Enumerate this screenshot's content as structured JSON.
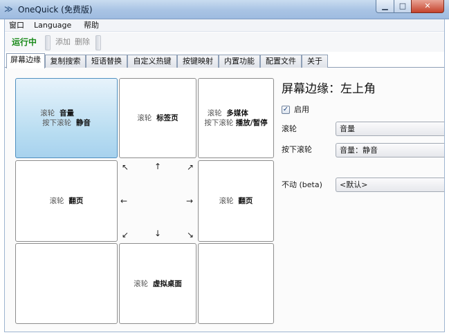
{
  "window": {
    "title": "OneQuick (免费版)",
    "minimize_glyph": "▁",
    "maximize_glyph": "□",
    "close_glyph": "✕"
  },
  "menubar": {
    "items": [
      "窗口",
      "Language",
      "帮助"
    ]
  },
  "toolbar": {
    "run_label": "运行中",
    "add_label": "添加",
    "delete_label": "删除"
  },
  "tabs": [
    {
      "label": "屏幕边缘",
      "active": true
    },
    {
      "label": "复制搜索"
    },
    {
      "label": "短语替换"
    },
    {
      "label": "自定义热键"
    },
    {
      "label": "按键映射"
    },
    {
      "label": "内置功能"
    },
    {
      "label": "配置文件"
    },
    {
      "label": "关于"
    }
  ],
  "grid": {
    "top_left": {
      "line1_key": "滚轮",
      "line1_val": "音量",
      "line2_key": "按下滚轮",
      "line2_val": "静音"
    },
    "top_center": {
      "line1_key": "滚轮",
      "line1_val": "标签页"
    },
    "top_right": {
      "line1_key": "滚轮",
      "line1_val": "多媒体",
      "line2_key": "按下滚轮",
      "line2_val": "播放/暂停"
    },
    "middle_left": {
      "line1_key": "滚轮",
      "line1_val": "翻页"
    },
    "middle_right": {
      "line1_key": "滚轮",
      "line1_val": "翻页"
    },
    "bottom_center": {
      "line1_key": "滚轮",
      "line1_val": "虚拟桌面"
    },
    "arrows": {
      "nw": "↖",
      "n": "↑",
      "ne": "↗",
      "w": "←",
      "e": "→",
      "sw": "↙",
      "s": "↓",
      "se": "↘"
    }
  },
  "detail": {
    "title": "屏幕边缘：左上角",
    "enabled_label": "启用",
    "enabled_checked": true,
    "check_glyph": "✓",
    "wheel_label": "滚轮",
    "wheel_value": "音量",
    "press_wheel_label": "按下滚轮",
    "press_wheel_value": "音量：静音",
    "idle_label": "不动 (beta)",
    "idle_value": "<默认>"
  },
  "colors": {
    "run_green": "#1a8a1a",
    "selected_blue": "#b7dcf1",
    "close_red": "#c5422b"
  }
}
